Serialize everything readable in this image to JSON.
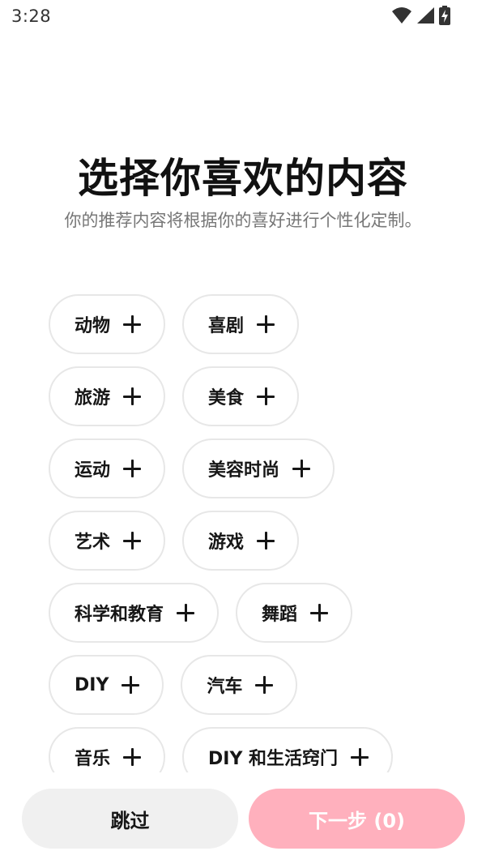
{
  "status_bar": {
    "time": "3:28",
    "icons": [
      "wifi-icon",
      "cell-signal-icon",
      "battery-charging-icon"
    ]
  },
  "title": "选择你喜欢的内容",
  "subtitle": "你的推荐内容将根据你的喜好进行个性化定制。",
  "chip_rows": [
    [
      "动物",
      "喜剧"
    ],
    [
      "旅游",
      "美食"
    ],
    [
      "运动",
      "美容时尚"
    ],
    [
      "艺术",
      "游戏"
    ],
    [
      "科学和教育",
      "舞蹈"
    ],
    [
      "DIY",
      "汽车"
    ],
    [
      "音乐",
      "DIY 和生活窍门"
    ]
  ],
  "buttons": {
    "skip_label": "跳过",
    "next_label": "下一步 (0)"
  },
  "colors": {
    "next_button_bg": "#ffb0bd",
    "skip_button_bg": "#f0f0f0",
    "chip_border": "#e7e7e7",
    "subtitle_text": "#777777"
  }
}
